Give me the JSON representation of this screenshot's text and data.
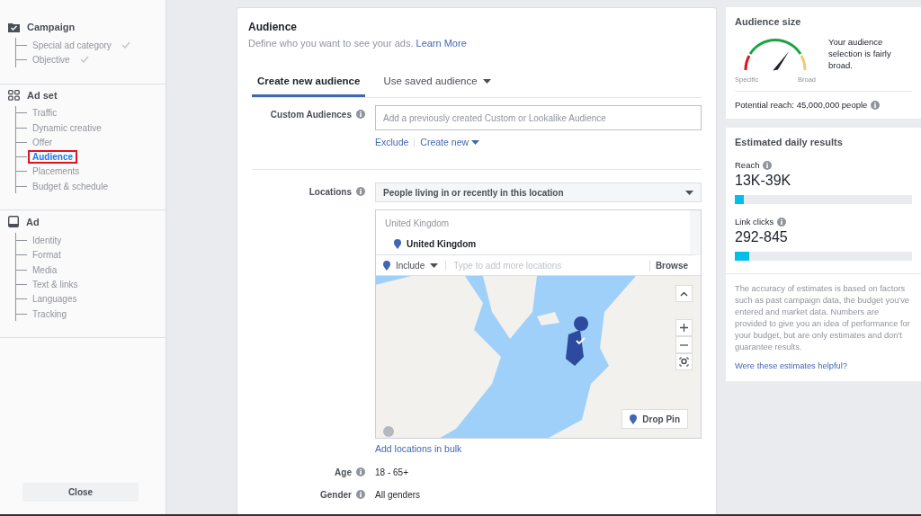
{
  "sidebar": {
    "sections": [
      {
        "kind": "campaign",
        "title": "Campaign",
        "items": [
          {
            "label": "Special ad category",
            "checked": true,
            "selected": false
          },
          {
            "label": "Objective",
            "checked": true,
            "selected": false
          }
        ]
      },
      {
        "kind": "adset",
        "title": "Ad set",
        "items": [
          {
            "label": "Traffic",
            "checked": false,
            "selected": false
          },
          {
            "label": "Dynamic creative",
            "checked": false,
            "selected": false
          },
          {
            "label": "Offer",
            "checked": false,
            "selected": false
          },
          {
            "label": "Audience",
            "checked": false,
            "selected": true
          },
          {
            "label": "Placements",
            "checked": false,
            "selected": false
          },
          {
            "label": "Budget & schedule",
            "checked": false,
            "selected": false
          }
        ]
      },
      {
        "kind": "ad",
        "title": "Ad",
        "items": [
          {
            "label": "Identity",
            "checked": false,
            "selected": false
          },
          {
            "label": "Format",
            "checked": false,
            "selected": false
          },
          {
            "label": "Media",
            "checked": false,
            "selected": false
          },
          {
            "label": "Text & links",
            "checked": false,
            "selected": false
          },
          {
            "label": "Languages",
            "checked": false,
            "selected": false
          },
          {
            "label": "Tracking",
            "checked": false,
            "selected": false
          }
        ]
      }
    ],
    "close_button": "Close"
  },
  "audience": {
    "title": "Audience",
    "subtitle": "Define who you want to see your ads.",
    "learn_more": "Learn More",
    "tabs": [
      {
        "label": "Create new audience",
        "selected": true,
        "kind": "plain"
      },
      {
        "label": "Use saved audience",
        "selected": false,
        "kind": "dropdown"
      }
    ],
    "custom_audiences": {
      "label": "Custom Audiences",
      "placeholder": "Add a previously created Custom or Lookalike Audience",
      "exclude": "Exclude",
      "create_new": "Create new"
    },
    "locations": {
      "label": "Locations",
      "select": "People living in or recently in this location",
      "group": "United Kingdom",
      "selected_location": "United Kingdom",
      "include": "Include",
      "placeholder": "Type to add more locations",
      "browse": "Browse",
      "drop_pin": "Drop Pin",
      "bulk": "Add locations in bulk"
    },
    "age": {
      "label": "Age",
      "value": "18 - 65+"
    },
    "gender": {
      "label": "Gender",
      "value": "All genders"
    }
  },
  "audience_size": {
    "title": "Audience size",
    "gauge": {
      "specific": "Specific",
      "broad": "Broad"
    },
    "description": "Your audience selection is fairly broad.",
    "potential_reach": "Potential reach: 45,000,000 people"
  },
  "estimated": {
    "title": "Estimated daily results",
    "metrics": [
      {
        "label": "Reach",
        "value": "13K-39K",
        "level": 0.05
      },
      {
        "label": "Link clicks",
        "value": "292-845",
        "level": 0.08
      }
    ],
    "note": "The accuracy of estimates is based on factors such as past campaign data, the budget you've entered and market data. Numbers are provided to give you an idea of performance for your budget, but are only estimates and don't guarantee results.",
    "helpful": "Were these estimates helpful?"
  }
}
